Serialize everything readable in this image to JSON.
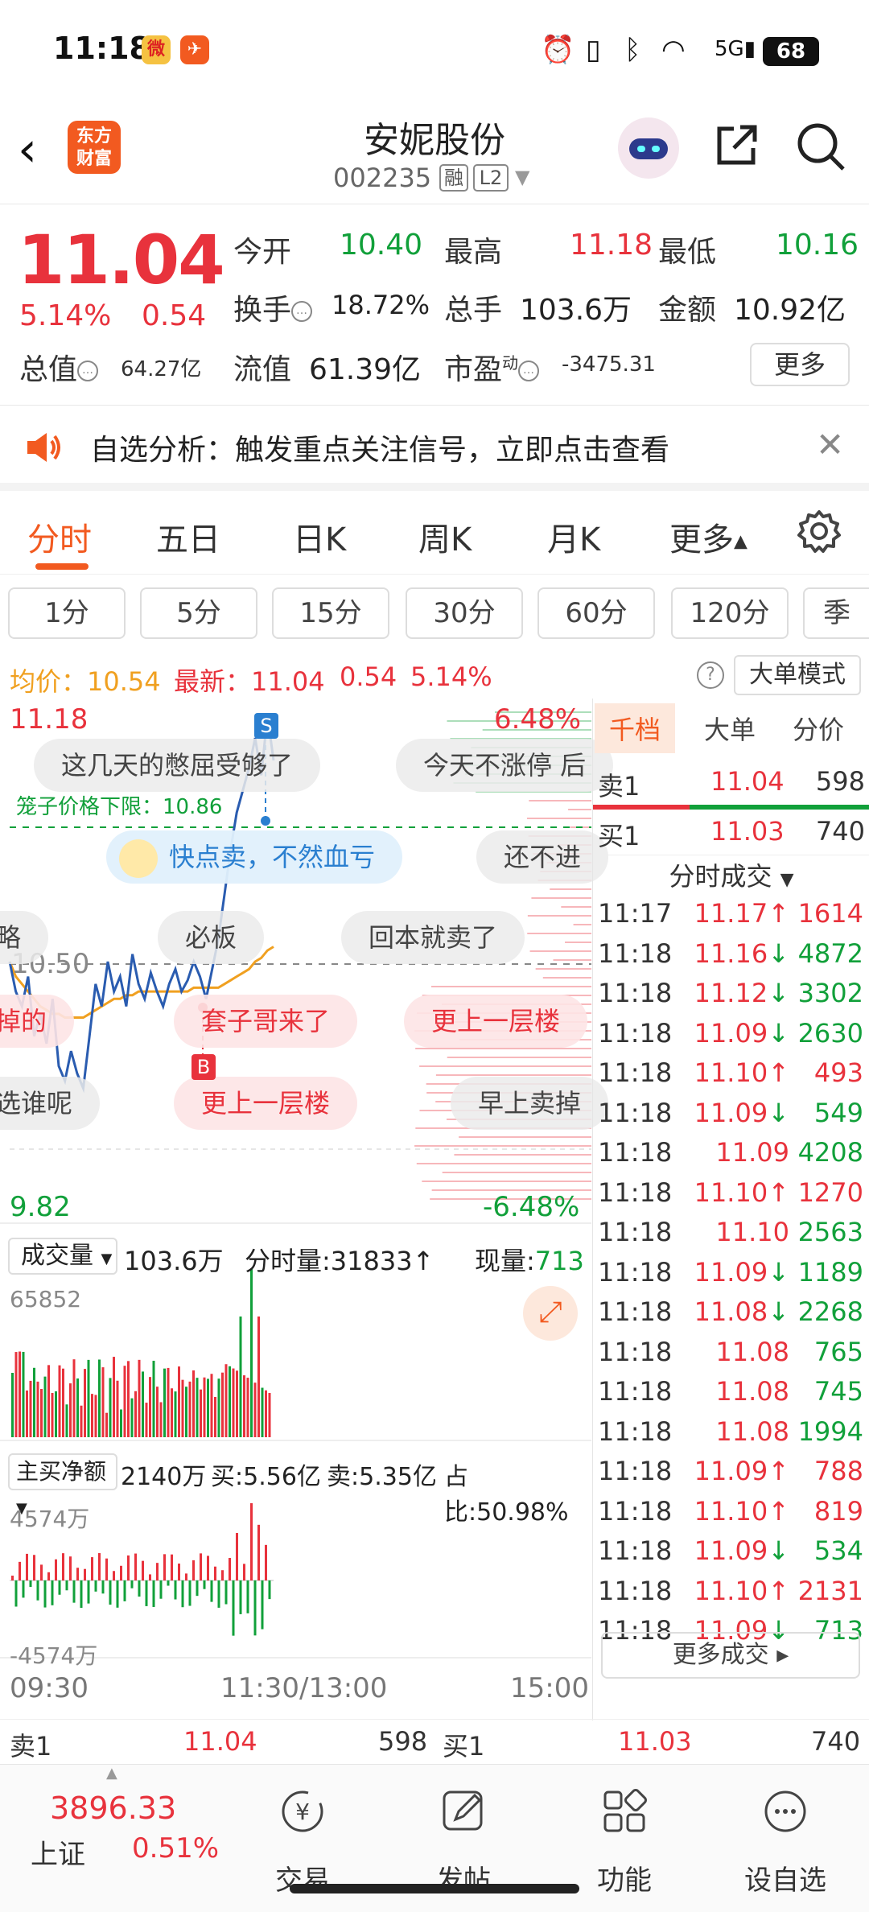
{
  "status_bar": {
    "time": "11:18",
    "battery": "68",
    "network": "5G"
  },
  "header": {
    "back_icon": "chevron-left-icon",
    "logo_text_1": "东方",
    "logo_text_2": "财富",
    "stock_name": "安妮股份",
    "stock_code": "002235",
    "tag_margin": "融",
    "tag_level": "L2"
  },
  "quote": {
    "price": "11.04",
    "change_pct": "5.14%",
    "change": "0.54",
    "open_label": "今开",
    "open": "10.40",
    "high_label": "最高",
    "high": "11.18",
    "low_label": "最低",
    "low": "10.16",
    "turnover_label": "换手",
    "turnover": "18.72%",
    "volume_label": "总手",
    "volume": "103.6万",
    "amount_label": "金额",
    "amount": "10.92亿",
    "mktcap_label": "总值",
    "mktcap": "64.27亿",
    "float_label": "流值",
    "float_cap": "61.39亿",
    "pe_label": "市盈",
    "pe_sup": "动",
    "pe": "-3475.31",
    "more": "更多"
  },
  "notice": {
    "text": "自选分析：触发重点关注信号，立即点击查看"
  },
  "tabs": [
    "分时",
    "五日",
    "日K",
    "周K",
    "月K",
    "更多"
  ],
  "periods": [
    "1分",
    "5分",
    "15分",
    "30分",
    "60分",
    "120分",
    "季"
  ],
  "avg_line": {
    "avg_label": "均价：",
    "avg": "10.54",
    "last_label": "最新：",
    "last": "11.04",
    "chg": "0.54",
    "pct": "5.14%",
    "big_order": "大单模式"
  },
  "chart": {
    "y_top": "11.18",
    "y_top_pct": "6.48%",
    "y_bottom": "9.82",
    "y_bottom_pct": "-6.48%",
    "mid_price": "10.50",
    "limit_label": "笼子价格下限：10.86",
    "marker_s": "S",
    "marker_b": "B",
    "bubbles": [
      "这几天的憋屈受够了",
      "今天不涨停 后",
      "快点卖，不然血亏",
      "还不进",
      "必板",
      "回本就卖了",
      "略",
      "掉的",
      "套子哥来了",
      "更上一层楼",
      "选谁呢",
      "更上一层楼",
      "早上卖掉"
    ],
    "vol_label": "成交量",
    "vol_total": "103.6万",
    "tick_vol_label": "分时量:",
    "tick_vol": "31833",
    "now_vol_label": "现量:",
    "now_vol": "713",
    "vol_max": "65852",
    "net_label": "主买净额",
    "net": "2140万",
    "buy_label": "买:",
    "buy": "5.56亿",
    "sell_label": "卖:",
    "sell": "5.35亿",
    "ratio_label": "占比:",
    "ratio": "50.98%",
    "net_max": "4574万",
    "net_min": "-4574万",
    "time_start": "09:30",
    "time_mid": "11:30/13:00",
    "time_end": "15:00"
  },
  "chart_data": {
    "type": "line",
    "title": "",
    "ylim": [
      9.82,
      11.18
    ],
    "x_ticks": [
      "09:30",
      "11:30/13:00",
      "15:00"
    ],
    "series": [
      {
        "values": [
          10.5,
          10.42,
          10.38,
          10.46,
          10.3,
          10.36,
          10.28,
          10.4,
          10.22,
          10.18,
          10.26,
          10.2,
          10.16,
          10.3,
          10.44,
          10.38,
          10.5,
          10.42,
          10.46,
          10.38,
          10.52,
          10.44,
          10.4,
          10.47,
          10.42,
          10.38,
          10.44,
          10.48,
          10.42,
          10.45,
          10.5,
          10.46,
          10.4,
          10.48,
          10.56,
          10.68,
          10.8,
          10.9,
          10.96,
          11.02,
          11.1,
          11.0,
          11.16,
          11.04
        ]
      },
      {
        "values": [
          10.5,
          10.46,
          10.44,
          10.42,
          10.4,
          10.38,
          10.37,
          10.36,
          10.36,
          10.35,
          10.35,
          10.35,
          10.35,
          10.36,
          10.37,
          10.38,
          10.39,
          10.4,
          10.4,
          10.41,
          10.41,
          10.42,
          10.42,
          10.42,
          10.42,
          10.42,
          10.42,
          10.42,
          10.42,
          10.42,
          10.43,
          10.43,
          10.43,
          10.43,
          10.43,
          10.44,
          10.45,
          10.46,
          10.47,
          10.48,
          10.5,
          10.51,
          10.53,
          10.54
        ]
      }
    ]
  },
  "orderbook": {
    "tabs": [
      "千档",
      "大单",
      "分价"
    ],
    "sell1_label": "卖1",
    "sell1_price": "11.04",
    "sell1_vol": "598",
    "buy1_label": "买1",
    "buy1_price": "11.03",
    "buy1_vol": "740"
  },
  "trades_header": "分时成交",
  "trades": [
    {
      "time": "11:17",
      "price": "11.17",
      "dir": "↑",
      "vol": "1614"
    },
    {
      "time": "11:18",
      "price": "11.16",
      "dir": "↓",
      "vol": "4872"
    },
    {
      "time": "11:18",
      "price": "11.12",
      "dir": "↓",
      "vol": "3302"
    },
    {
      "time": "11:18",
      "price": "11.09",
      "dir": "↓",
      "vol": "2630"
    },
    {
      "time": "11:18",
      "price": "11.10",
      "dir": "↑",
      "vol": "493"
    },
    {
      "time": "11:18",
      "price": "11.09",
      "dir": "↓",
      "vol": "549"
    },
    {
      "time": "11:18",
      "price": "11.09",
      "dir": "",
      "vol": "4208"
    },
    {
      "time": "11:18",
      "price": "11.10",
      "dir": "↑",
      "vol": "1270"
    },
    {
      "time": "11:18",
      "price": "11.10",
      "dir": "",
      "vol": "2563"
    },
    {
      "time": "11:18",
      "price": "11.09",
      "dir": "↓",
      "vol": "1189"
    },
    {
      "time": "11:18",
      "price": "11.08",
      "dir": "↓",
      "vol": "2268"
    },
    {
      "time": "11:18",
      "price": "11.08",
      "dir": "",
      "vol": "765"
    },
    {
      "time": "11:18",
      "price": "11.08",
      "dir": "",
      "vol": "745"
    },
    {
      "time": "11:18",
      "price": "11.08",
      "dir": "",
      "vol": "1994"
    },
    {
      "time": "11:18",
      "price": "11.09",
      "dir": "↑",
      "vol": "788"
    },
    {
      "time": "11:18",
      "price": "11.10",
      "dir": "↑",
      "vol": "819"
    },
    {
      "time": "11:18",
      "price": "11.09",
      "dir": "↓",
      "vol": "534"
    },
    {
      "time": "11:18",
      "price": "11.10",
      "dir": "↑",
      "vol": "2131"
    },
    {
      "time": "11:18",
      "price": "11.09",
      "dir": "↓",
      "vol": "713"
    }
  ],
  "more_trades": "更多成交",
  "bottom_quote": {
    "sell1_label": "卖1",
    "sell1_price": "11.04",
    "sell1_vol": "598",
    "buy1_label": "买1",
    "buy1_price": "11.03",
    "buy1_vol": "740"
  },
  "bottom_nav": {
    "index_value": "3896.33",
    "index_name": "上证",
    "index_pct": "0.51%",
    "items": [
      "交易",
      "发帖",
      "功能",
      "设自选"
    ]
  },
  "colors": {
    "up": "#e8323c",
    "down": "#11a03a",
    "accent": "#f25a20",
    "price_line": "#2a5cb0",
    "avg_line": "#f0a020"
  }
}
